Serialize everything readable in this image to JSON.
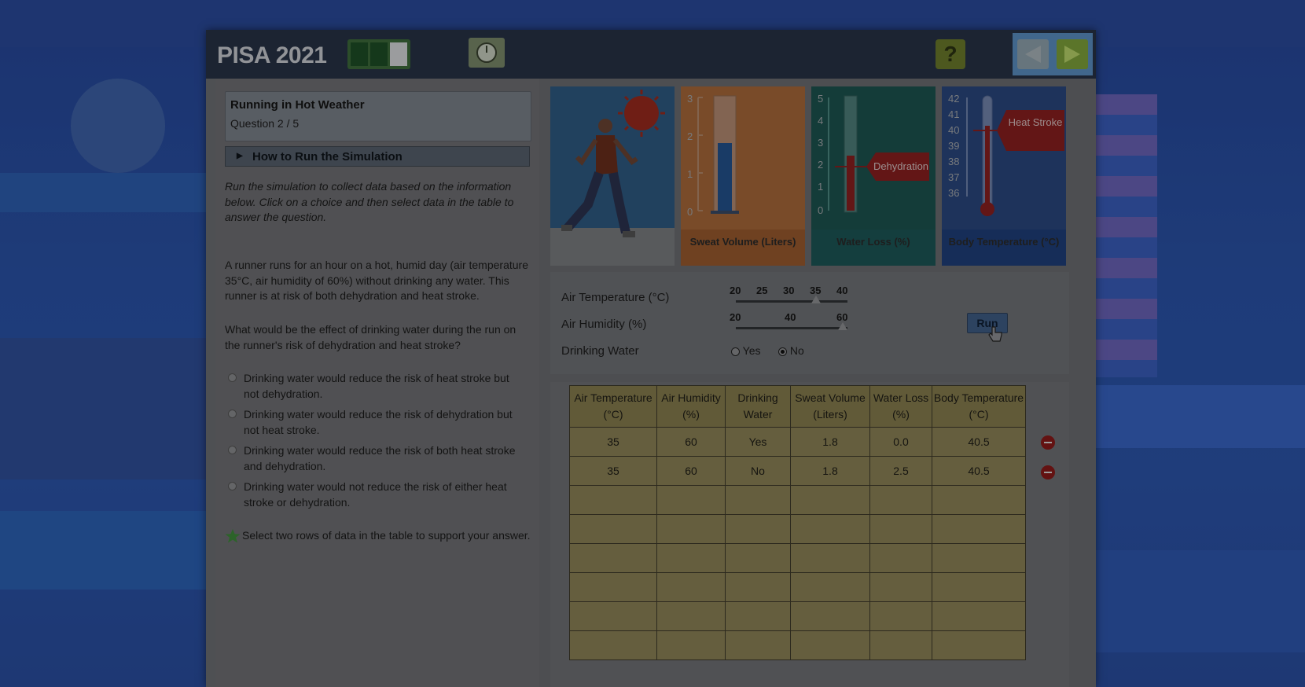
{
  "header": {
    "brand": "PISA 2021",
    "help_label": "?"
  },
  "question": {
    "title": "Running in Hot Weather",
    "number": "Question 2 / 5",
    "howto_label": "How to Run the Simulation",
    "intro": "Run the simulation to collect data based on the information below. Click on a choice and then select data in the table to answer the question.",
    "scenario": "A runner runs for an hour on a hot, humid day (air temperature 35°C, air humidity of 60%) without drinking any water. This runner is at risk of both dehydration and heat stroke.",
    "prompt": "What would be the effect of drinking water during the run on the runner's risk of dehydration and heat stroke?",
    "choices": [
      "Drinking water would reduce the risk of heat stroke but not dehydration.",
      "Drinking water would reduce the risk of dehydration but not heat stroke.",
      "Drinking water would reduce the risk of both heat stroke and dehydration.",
      "Drinking water would not reduce the risk of either heat stroke or dehydration."
    ],
    "instruction": "Select two rows of data in the table to support your answer."
  },
  "meters": {
    "sweat": {
      "label": "Sweat Volume (Liters)",
      "ticks": [
        "3",
        "2",
        "1",
        "0"
      ],
      "value": 1.8
    },
    "water": {
      "label": "Water Loss (%)",
      "ticks": [
        "5",
        "4",
        "3",
        "2",
        "1",
        "0"
      ],
      "value": 2.5,
      "flag": "Dehydration"
    },
    "body": {
      "label": "Body Temperature (°C)",
      "ticks": [
        "42",
        "41",
        "40",
        "39",
        "38",
        "37",
        "36"
      ],
      "value": 40.5,
      "flag": "Heat Stroke"
    }
  },
  "controls": {
    "air_temp": {
      "label": "Air Temperature (°C)",
      "ticks": [
        "20",
        "25",
        "30",
        "35",
        "40"
      ],
      "value": 35
    },
    "air_humidity": {
      "label": "Air Humidity (%)",
      "ticks": [
        "20",
        "40",
        "60"
      ],
      "value": 60
    },
    "drinking_water": {
      "label": "Drinking Water",
      "options": [
        "Yes",
        "No"
      ],
      "selected": "No"
    },
    "run_label": "Run"
  },
  "table": {
    "headers": [
      "Air Temperature (°C)",
      "Air Humidity (%)",
      "Drinking Water",
      "Sweat Volume (Liters)",
      "Water Loss (%)",
      "Body Temperature (°C)"
    ],
    "rows": [
      [
        "35",
        "60",
        "Yes",
        "1.8",
        "0.0",
        "40.5"
      ],
      [
        "35",
        "60",
        "No",
        "1.8",
        "2.5",
        "40.5"
      ]
    ],
    "empty_rows": 6
  },
  "colors": {
    "accent_green": "#7ea33b",
    "table_fill": "#8c8356",
    "remove_red": "#8a1a1a"
  }
}
